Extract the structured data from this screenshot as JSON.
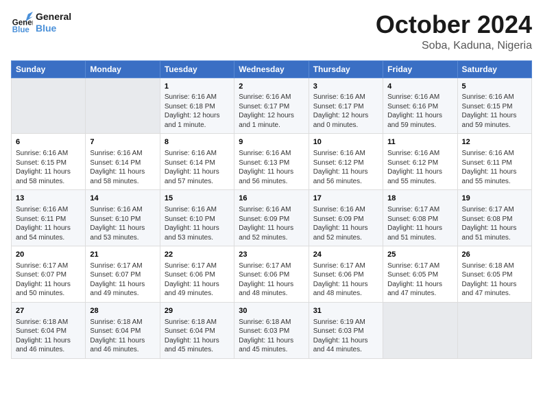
{
  "header": {
    "logo_line1": "General",
    "logo_line2": "Blue",
    "month_title": "October 2024",
    "location": "Soba, Kaduna, Nigeria"
  },
  "days_of_week": [
    "Sunday",
    "Monday",
    "Tuesday",
    "Wednesday",
    "Thursday",
    "Friday",
    "Saturday"
  ],
  "weeks": [
    [
      {
        "day": "",
        "info": ""
      },
      {
        "day": "",
        "info": ""
      },
      {
        "day": "1",
        "info": "Sunrise: 6:16 AM\nSunset: 6:18 PM\nDaylight: 12 hours\nand 1 minute."
      },
      {
        "day": "2",
        "info": "Sunrise: 6:16 AM\nSunset: 6:17 PM\nDaylight: 12 hours\nand 1 minute."
      },
      {
        "day": "3",
        "info": "Sunrise: 6:16 AM\nSunset: 6:17 PM\nDaylight: 12 hours\nand 0 minutes."
      },
      {
        "day": "4",
        "info": "Sunrise: 6:16 AM\nSunset: 6:16 PM\nDaylight: 11 hours\nand 59 minutes."
      },
      {
        "day": "5",
        "info": "Sunrise: 6:16 AM\nSunset: 6:15 PM\nDaylight: 11 hours\nand 59 minutes."
      }
    ],
    [
      {
        "day": "6",
        "info": "Sunrise: 6:16 AM\nSunset: 6:15 PM\nDaylight: 11 hours\nand 58 minutes."
      },
      {
        "day": "7",
        "info": "Sunrise: 6:16 AM\nSunset: 6:14 PM\nDaylight: 11 hours\nand 58 minutes."
      },
      {
        "day": "8",
        "info": "Sunrise: 6:16 AM\nSunset: 6:14 PM\nDaylight: 11 hours\nand 57 minutes."
      },
      {
        "day": "9",
        "info": "Sunrise: 6:16 AM\nSunset: 6:13 PM\nDaylight: 11 hours\nand 56 minutes."
      },
      {
        "day": "10",
        "info": "Sunrise: 6:16 AM\nSunset: 6:12 PM\nDaylight: 11 hours\nand 56 minutes."
      },
      {
        "day": "11",
        "info": "Sunrise: 6:16 AM\nSunset: 6:12 PM\nDaylight: 11 hours\nand 55 minutes."
      },
      {
        "day": "12",
        "info": "Sunrise: 6:16 AM\nSunset: 6:11 PM\nDaylight: 11 hours\nand 55 minutes."
      }
    ],
    [
      {
        "day": "13",
        "info": "Sunrise: 6:16 AM\nSunset: 6:11 PM\nDaylight: 11 hours\nand 54 minutes."
      },
      {
        "day": "14",
        "info": "Sunrise: 6:16 AM\nSunset: 6:10 PM\nDaylight: 11 hours\nand 53 minutes."
      },
      {
        "day": "15",
        "info": "Sunrise: 6:16 AM\nSunset: 6:10 PM\nDaylight: 11 hours\nand 53 minutes."
      },
      {
        "day": "16",
        "info": "Sunrise: 6:16 AM\nSunset: 6:09 PM\nDaylight: 11 hours\nand 52 minutes."
      },
      {
        "day": "17",
        "info": "Sunrise: 6:16 AM\nSunset: 6:09 PM\nDaylight: 11 hours\nand 52 minutes."
      },
      {
        "day": "18",
        "info": "Sunrise: 6:17 AM\nSunset: 6:08 PM\nDaylight: 11 hours\nand 51 minutes."
      },
      {
        "day": "19",
        "info": "Sunrise: 6:17 AM\nSunset: 6:08 PM\nDaylight: 11 hours\nand 51 minutes."
      }
    ],
    [
      {
        "day": "20",
        "info": "Sunrise: 6:17 AM\nSunset: 6:07 PM\nDaylight: 11 hours\nand 50 minutes."
      },
      {
        "day": "21",
        "info": "Sunrise: 6:17 AM\nSunset: 6:07 PM\nDaylight: 11 hours\nand 49 minutes."
      },
      {
        "day": "22",
        "info": "Sunrise: 6:17 AM\nSunset: 6:06 PM\nDaylight: 11 hours\nand 49 minutes."
      },
      {
        "day": "23",
        "info": "Sunrise: 6:17 AM\nSunset: 6:06 PM\nDaylight: 11 hours\nand 48 minutes."
      },
      {
        "day": "24",
        "info": "Sunrise: 6:17 AM\nSunset: 6:06 PM\nDaylight: 11 hours\nand 48 minutes."
      },
      {
        "day": "25",
        "info": "Sunrise: 6:17 AM\nSunset: 6:05 PM\nDaylight: 11 hours\nand 47 minutes."
      },
      {
        "day": "26",
        "info": "Sunrise: 6:18 AM\nSunset: 6:05 PM\nDaylight: 11 hours\nand 47 minutes."
      }
    ],
    [
      {
        "day": "27",
        "info": "Sunrise: 6:18 AM\nSunset: 6:04 PM\nDaylight: 11 hours\nand 46 minutes."
      },
      {
        "day": "28",
        "info": "Sunrise: 6:18 AM\nSunset: 6:04 PM\nDaylight: 11 hours\nand 46 minutes."
      },
      {
        "day": "29",
        "info": "Sunrise: 6:18 AM\nSunset: 6:04 PM\nDaylight: 11 hours\nand 45 minutes."
      },
      {
        "day": "30",
        "info": "Sunrise: 6:18 AM\nSunset: 6:03 PM\nDaylight: 11 hours\nand 45 minutes."
      },
      {
        "day": "31",
        "info": "Sunrise: 6:19 AM\nSunset: 6:03 PM\nDaylight: 11 hours\nand 44 minutes."
      },
      {
        "day": "",
        "info": ""
      },
      {
        "day": "",
        "info": ""
      }
    ]
  ]
}
